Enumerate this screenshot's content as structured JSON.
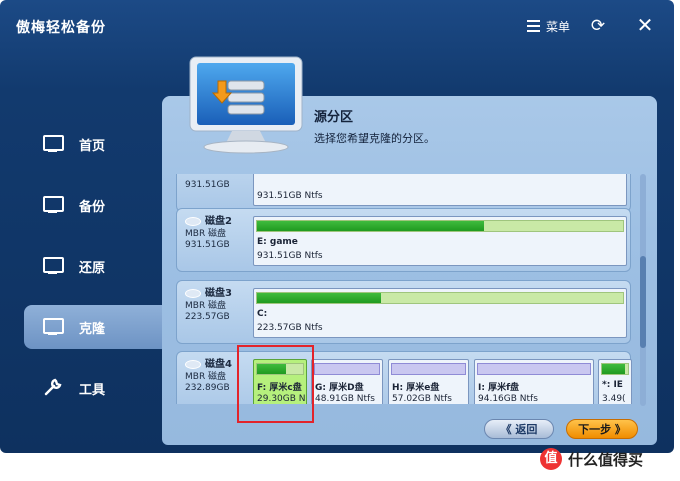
{
  "window": {
    "title": "傲梅轻松备份",
    "menu_label": "菜单",
    "refresh_glyph": "⟳",
    "close_glyph": "✕"
  },
  "sidebar": {
    "items": [
      {
        "label": "首页",
        "icon": "home-monitor-icon",
        "active": false
      },
      {
        "label": "备份",
        "icon": "backup-monitor-icon",
        "active": false
      },
      {
        "label": "还原",
        "icon": "restore-monitor-icon",
        "active": false
      },
      {
        "label": "克隆",
        "icon": "clone-monitor-icon",
        "active": true
      },
      {
        "label": "工具",
        "icon": "wrench-icon",
        "active": false
      }
    ]
  },
  "header": {
    "title": "源分区",
    "subtitle": "选择您希望克隆的分区。"
  },
  "disks": [
    {
      "name": "",
      "type": "",
      "size": "931.51GB",
      "partitions": [
        {
          "label": "",
          "size": "931.51GB Ntfs"
        }
      ]
    },
    {
      "name": "磁盘2",
      "type": "MBR 磁盘",
      "size": "931.51GB",
      "partitions": [
        {
          "label": "E: game",
          "size": "931.51GB Ntfs",
          "used_fraction": 0.62
        }
      ]
    },
    {
      "name": "磁盘3",
      "type": "MBR 磁盘",
      "size": "223.57GB",
      "partitions": [
        {
          "label": "C:",
          "size": "223.57GB Ntfs",
          "used_fraction": 0.34
        }
      ]
    },
    {
      "name": "磁盘4",
      "type": "MBR 磁盘",
      "size": "232.89GB",
      "partitions": [
        {
          "label": "F: 厚米c盘",
          "size": "29.30GB N",
          "used_fraction": 0.62,
          "selected": true
        },
        {
          "label": "G: 厚米D盘",
          "size": "48.91GB Ntfs",
          "used_fraction": 0.0
        },
        {
          "label": "H: 厚米e盘",
          "size": "57.02GB Ntfs",
          "used_fraction": 0.0
        },
        {
          "label": "I: 厚米f盘",
          "size": "94.16GB Ntfs",
          "used_fraction": 0.0
        },
        {
          "label": "*: IE",
          "size": "3.49(",
          "used_fraction": 0.9
        }
      ]
    }
  ],
  "buttons": {
    "back": "《 返回",
    "next": "下一步 》"
  },
  "watermark": {
    "icon_text": "值",
    "text": "什么值得买"
  },
  "colors": {
    "window_bg": "#123a6e",
    "panel_bg": "#a9c8e8",
    "used_green": "#2aa52a",
    "free_green": "#c9e9a6",
    "selected_green": "#b6f07d",
    "highlight_red": "#e3232a",
    "next_orange": "#f5a000"
  }
}
